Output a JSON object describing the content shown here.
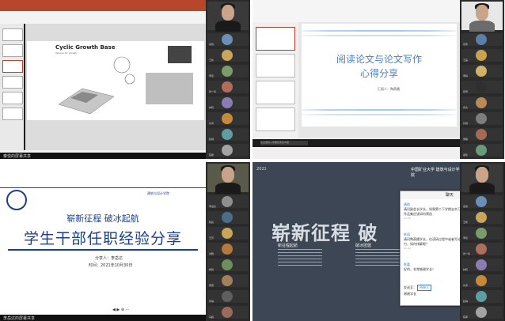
{
  "colors": {
    "ppt": "#b7472a",
    "navy": "#1d3f8a",
    "wps_blue": "#4a7fc8",
    "dark_slide": "#3c4654",
    "link": "#3a7bd5"
  },
  "q1": {
    "slide_title": "Cyclic Growth Base",
    "slide_subtitle": "Spaces for growth",
    "sharer_label": "秦悦的屏幕共享",
    "participants": [
      "秦悦",
      "王新",
      "李佳",
      "张一鸣",
      "林晓",
      "刘洋",
      "赵琳",
      "陈鹏"
    ]
  },
  "q2": {
    "title_line1": "阅读论文与论文写作",
    "title_line2": "心得分享",
    "reporter": "汇报人：陶燕娥",
    "taskbar_search": "在这里输入你要搜索的内容",
    "participants": [
      "张伟",
      "王磊",
      "李婷",
      "韩雪",
      "周杰",
      "孙颖",
      "吴敏",
      "郑凯"
    ]
  },
  "q3": {
    "header_line": "崭新征程 破冰起航",
    "main_title": "学生干部任职经验分享",
    "speaker": "分享人：李岳达",
    "date": "时间：2021年10月30日",
    "school_logo": "建筑与设计学院",
    "sharer_label": "李岳达的屏幕共享",
    "participants": [
      "李岳达",
      "陈晨",
      "王芳",
      "刘畅",
      "杨帆",
      "黄蕾",
      "何静",
      "马超"
    ]
  },
  "q4": {
    "year": "2021",
    "big_text": "崭新征程  破",
    "sec1": "新征程起航",
    "sec2": "破冰团建",
    "logo_text": "中国矿业大学 建筑与设计学院",
    "chat": {
      "title": "聊天",
      "messages": [
        {
          "who": "唐韵",
          "text": "请问副会长学长，如果第二下学期去实习，什么时候准备作品集，作品集应该如何筛选",
          "time": "11:23"
        },
        {
          "who": "陈园",
          "text": "请问陶燕娥学长，在读研过程中或者写论文的时候是会有一些压力，如何排解呢？",
          "time": "11:24"
        },
        {
          "who": "陈嘉",
          "text": "好的，非常感谢学长！",
          "time": ""
        }
      ],
      "send_to_label": "发送至：",
      "send_to_value": "所有人",
      "input_text": "谢谢学长"
    },
    "participants": [
      "秦悦",
      "王新",
      "李佳",
      "张一鸣",
      "林晓",
      "刘洋",
      "赵琳",
      "陈鹏"
    ]
  }
}
